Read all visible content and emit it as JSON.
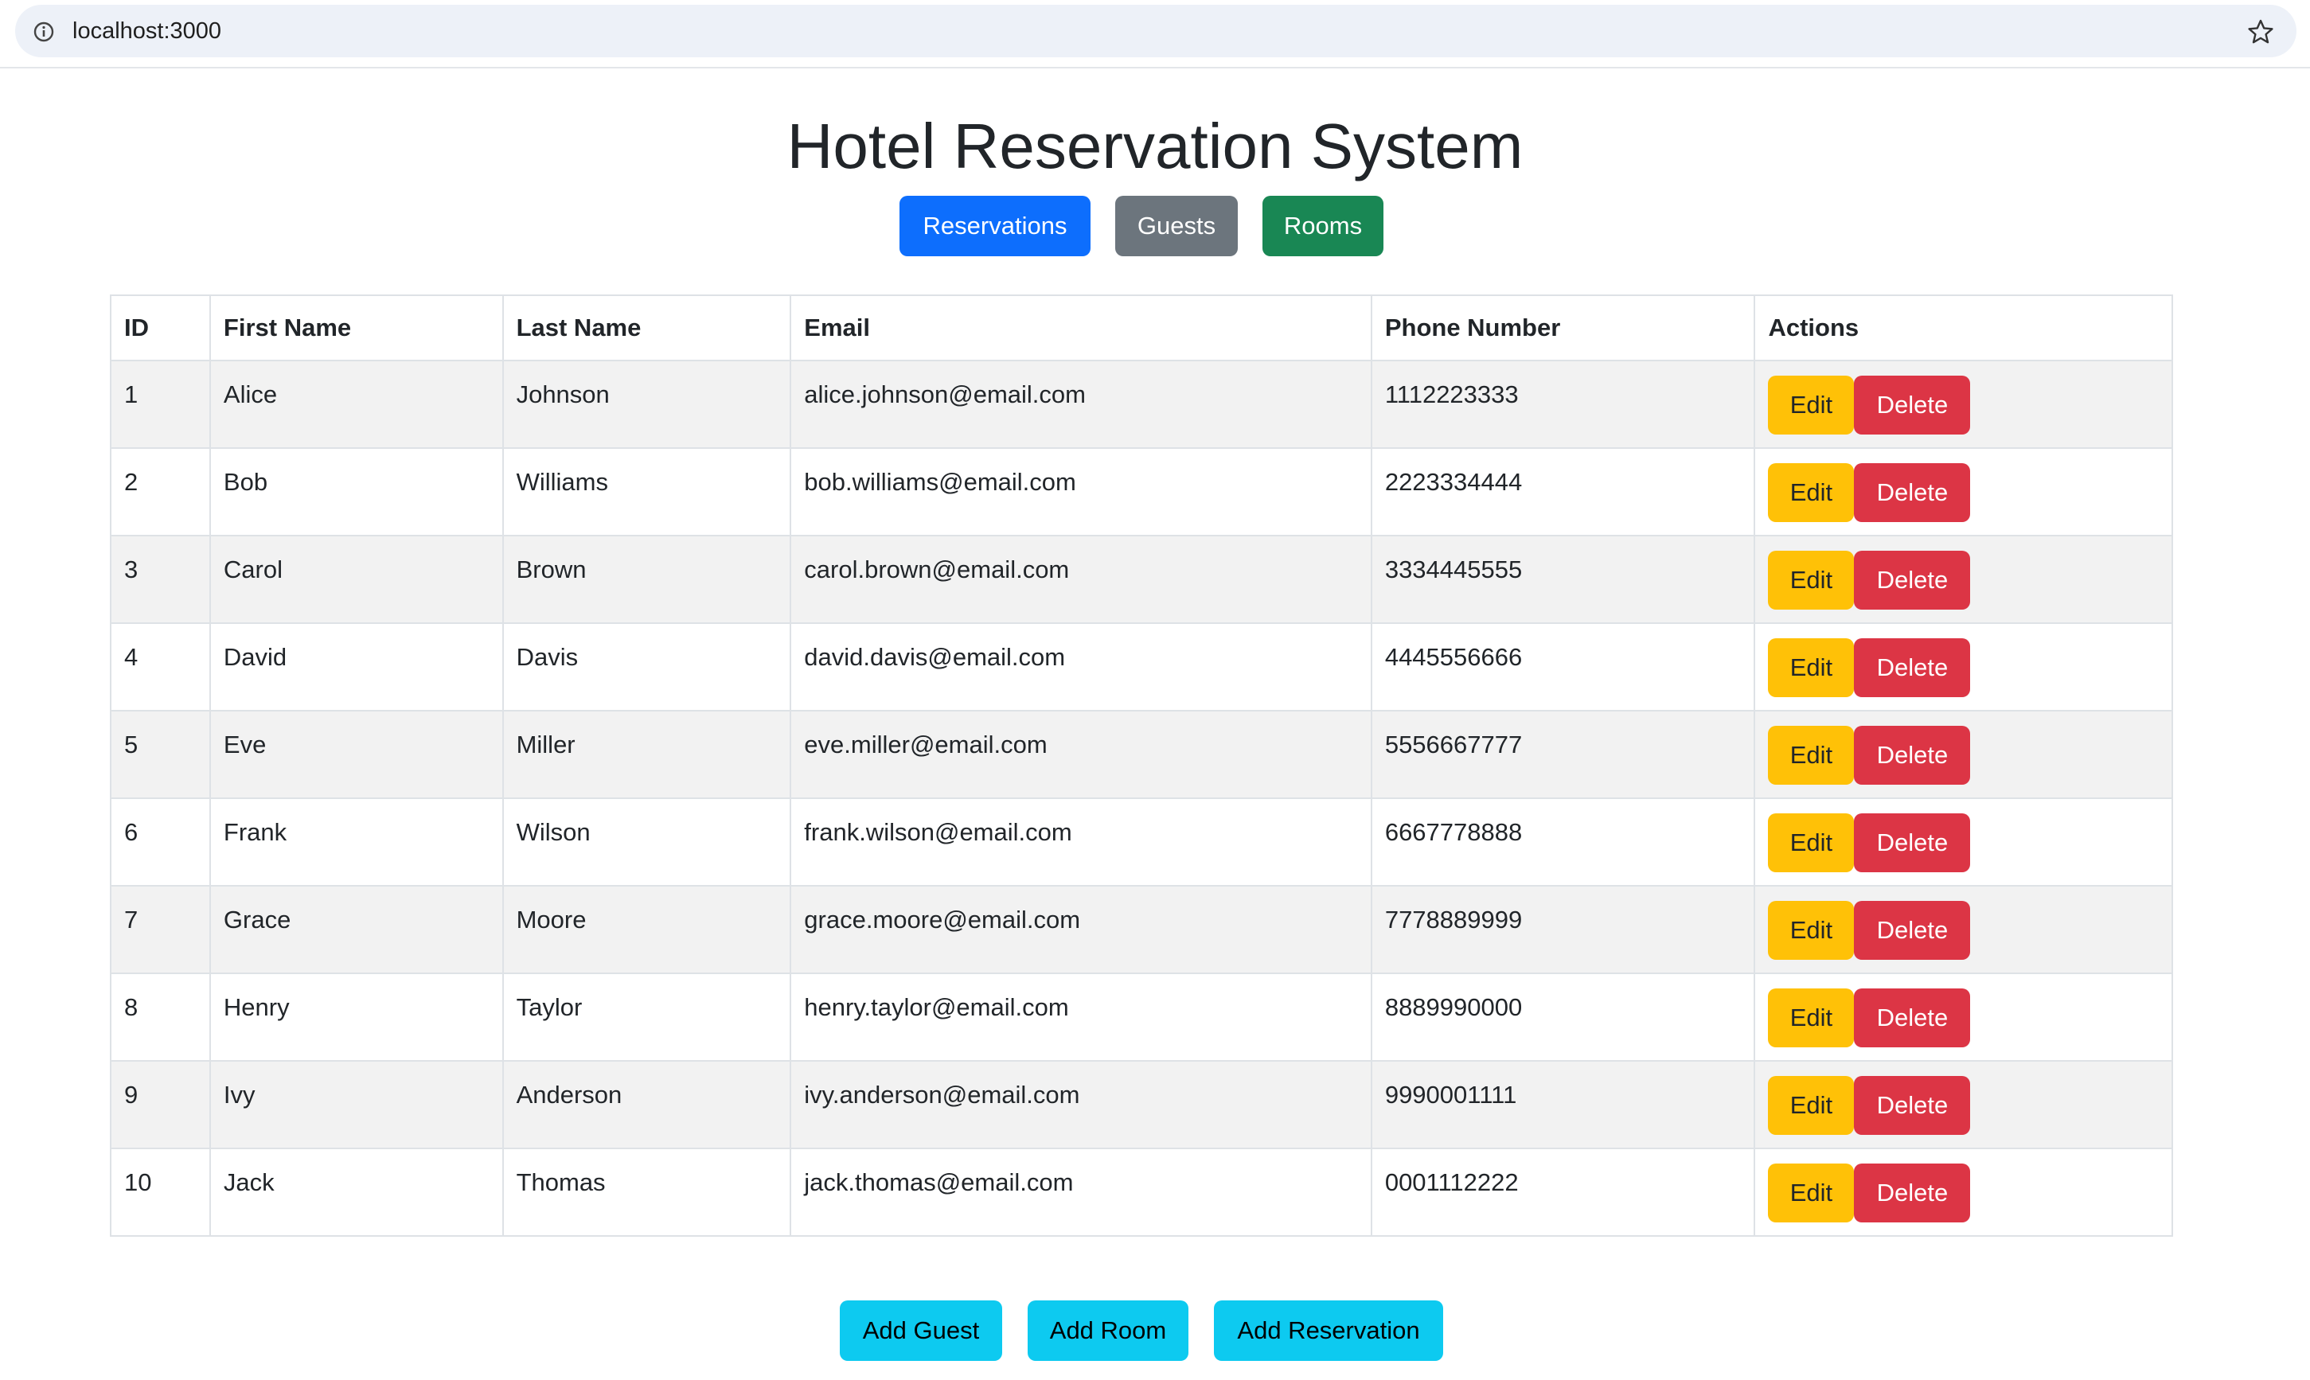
{
  "browser": {
    "url": "localhost:3000"
  },
  "page": {
    "title": "Hotel Reservation System"
  },
  "nav": {
    "reservations": "Reservations",
    "guests": "Guests",
    "rooms": "Rooms"
  },
  "table": {
    "headers": {
      "id": "ID",
      "first_name": "First Name",
      "last_name": "Last Name",
      "email": "Email",
      "phone": "Phone Number",
      "actions": "Actions"
    },
    "rows": [
      {
        "id": "1",
        "first_name": "Alice",
        "last_name": "Johnson",
        "email": "alice.johnson@email.com",
        "phone": "1112223333"
      },
      {
        "id": "2",
        "first_name": "Bob",
        "last_name": "Williams",
        "email": "bob.williams@email.com",
        "phone": "2223334444"
      },
      {
        "id": "3",
        "first_name": "Carol",
        "last_name": "Brown",
        "email": "carol.brown@email.com",
        "phone": "3334445555"
      },
      {
        "id": "4",
        "first_name": "David",
        "last_name": "Davis",
        "email": "david.davis@email.com",
        "phone": "4445556666"
      },
      {
        "id": "5",
        "first_name": "Eve",
        "last_name": "Miller",
        "email": "eve.miller@email.com",
        "phone": "5556667777"
      },
      {
        "id": "6",
        "first_name": "Frank",
        "last_name": "Wilson",
        "email": "frank.wilson@email.com",
        "phone": "6667778888"
      },
      {
        "id": "7",
        "first_name": "Grace",
        "last_name": "Moore",
        "email": "grace.moore@email.com",
        "phone": "7778889999"
      },
      {
        "id": "8",
        "first_name": "Henry",
        "last_name": "Taylor",
        "email": "henry.taylor@email.com",
        "phone": "8889990000"
      },
      {
        "id": "9",
        "first_name": "Ivy",
        "last_name": "Anderson",
        "email": "ivy.anderson@email.com",
        "phone": "9990001111"
      },
      {
        "id": "10",
        "first_name": "Jack",
        "last_name": "Thomas",
        "email": "jack.thomas@email.com",
        "phone": "0001112222"
      }
    ],
    "edit_label": "Edit",
    "delete_label": "Delete"
  },
  "footer_actions": {
    "add_guest": "Add Guest",
    "add_room": "Add Room",
    "add_reservation": "Add Reservation"
  },
  "colors": {
    "primary": "#0d6efd",
    "secondary": "#6c757d",
    "success": "#198754",
    "warning": "#ffc107",
    "danger": "#dc3545",
    "info": "#0dcaf0"
  }
}
